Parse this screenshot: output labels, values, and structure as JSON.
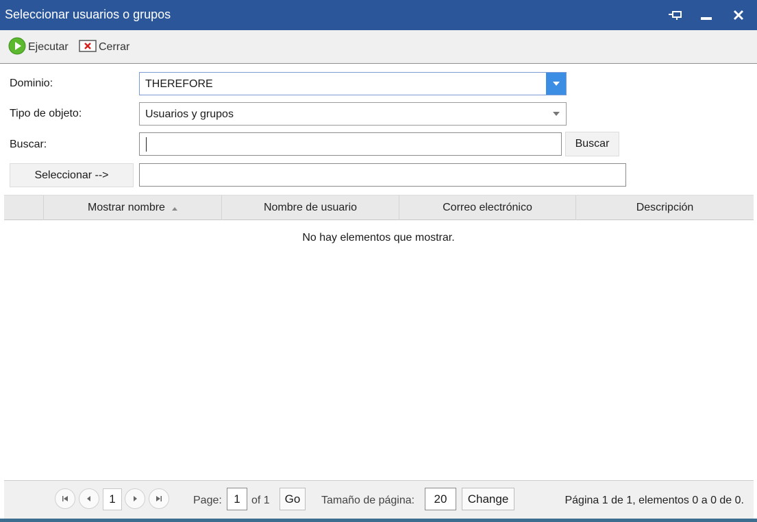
{
  "window": {
    "title": "Seleccionar usuarios o grupos",
    "controls": [
      "pin-icon",
      "minimize-icon",
      "close-icon"
    ]
  },
  "toolbar": {
    "run_label": "Ejecutar",
    "close_label": "Cerrar"
  },
  "form": {
    "domain_label": "Dominio:",
    "domain_value": "THEREFORE",
    "object_type_label": "Tipo de objeto:",
    "object_type_value": "Usuarios y grupos",
    "search_label": "Buscar:",
    "search_value": "",
    "search_button": "Buscar",
    "select_button": "Seleccionar -->",
    "selected_value": ""
  },
  "grid": {
    "columns": [
      "Mostrar nombre",
      "Nombre de usuario",
      "Correo electrónico",
      "Descripción"
    ],
    "sorted_column": "Mostrar nombre",
    "empty_message": "No hay elementos que mostrar."
  },
  "pager": {
    "current_page": "1",
    "page_label": "Page:",
    "page_input": "1",
    "of_label": "of 1",
    "go_label": "Go",
    "page_size_label": "Tamaño de página:",
    "page_size_value": "20",
    "change_label": "Change",
    "status": "Página 1 de 1, elementos 0 a 0 de 0."
  },
  "colors": {
    "titlebar": "#2b579a",
    "dropdown_accent": "#3c8de4",
    "run_icon": "#5cb82e",
    "close_icon": "#d32020"
  }
}
